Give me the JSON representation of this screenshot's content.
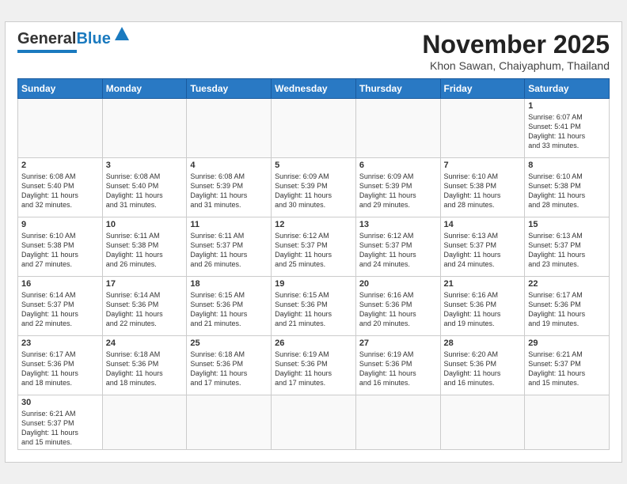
{
  "header": {
    "logo_general": "General",
    "logo_blue": "Blue",
    "month_title": "November 2025",
    "location": "Khon Sawan, Chaiyaphum, Thailand"
  },
  "weekdays": [
    "Sunday",
    "Monday",
    "Tuesday",
    "Wednesday",
    "Thursday",
    "Friday",
    "Saturday"
  ],
  "weeks": [
    [
      {
        "day": "",
        "info": ""
      },
      {
        "day": "",
        "info": ""
      },
      {
        "day": "",
        "info": ""
      },
      {
        "day": "",
        "info": ""
      },
      {
        "day": "",
        "info": ""
      },
      {
        "day": "",
        "info": ""
      },
      {
        "day": "1",
        "info": "Sunrise: 6:07 AM\nSunset: 5:41 PM\nDaylight: 11 hours\nand 33 minutes."
      }
    ],
    [
      {
        "day": "2",
        "info": "Sunrise: 6:08 AM\nSunset: 5:40 PM\nDaylight: 11 hours\nand 32 minutes."
      },
      {
        "day": "3",
        "info": "Sunrise: 6:08 AM\nSunset: 5:40 PM\nDaylight: 11 hours\nand 31 minutes."
      },
      {
        "day": "4",
        "info": "Sunrise: 6:08 AM\nSunset: 5:39 PM\nDaylight: 11 hours\nand 31 minutes."
      },
      {
        "day": "5",
        "info": "Sunrise: 6:09 AM\nSunset: 5:39 PM\nDaylight: 11 hours\nand 30 minutes."
      },
      {
        "day": "6",
        "info": "Sunrise: 6:09 AM\nSunset: 5:39 PM\nDaylight: 11 hours\nand 29 minutes."
      },
      {
        "day": "7",
        "info": "Sunrise: 6:10 AM\nSunset: 5:38 PM\nDaylight: 11 hours\nand 28 minutes."
      },
      {
        "day": "8",
        "info": "Sunrise: 6:10 AM\nSunset: 5:38 PM\nDaylight: 11 hours\nand 28 minutes."
      }
    ],
    [
      {
        "day": "9",
        "info": "Sunrise: 6:10 AM\nSunset: 5:38 PM\nDaylight: 11 hours\nand 27 minutes."
      },
      {
        "day": "10",
        "info": "Sunrise: 6:11 AM\nSunset: 5:38 PM\nDaylight: 11 hours\nand 26 minutes."
      },
      {
        "day": "11",
        "info": "Sunrise: 6:11 AM\nSunset: 5:37 PM\nDaylight: 11 hours\nand 26 minutes."
      },
      {
        "day": "12",
        "info": "Sunrise: 6:12 AM\nSunset: 5:37 PM\nDaylight: 11 hours\nand 25 minutes."
      },
      {
        "day": "13",
        "info": "Sunrise: 6:12 AM\nSunset: 5:37 PM\nDaylight: 11 hours\nand 24 minutes."
      },
      {
        "day": "14",
        "info": "Sunrise: 6:13 AM\nSunset: 5:37 PM\nDaylight: 11 hours\nand 24 minutes."
      },
      {
        "day": "15",
        "info": "Sunrise: 6:13 AM\nSunset: 5:37 PM\nDaylight: 11 hours\nand 23 minutes."
      }
    ],
    [
      {
        "day": "16",
        "info": "Sunrise: 6:14 AM\nSunset: 5:37 PM\nDaylight: 11 hours\nand 22 minutes."
      },
      {
        "day": "17",
        "info": "Sunrise: 6:14 AM\nSunset: 5:36 PM\nDaylight: 11 hours\nand 22 minutes."
      },
      {
        "day": "18",
        "info": "Sunrise: 6:15 AM\nSunset: 5:36 PM\nDaylight: 11 hours\nand 21 minutes."
      },
      {
        "day": "19",
        "info": "Sunrise: 6:15 AM\nSunset: 5:36 PM\nDaylight: 11 hours\nand 21 minutes."
      },
      {
        "day": "20",
        "info": "Sunrise: 6:16 AM\nSunset: 5:36 PM\nDaylight: 11 hours\nand 20 minutes."
      },
      {
        "day": "21",
        "info": "Sunrise: 6:16 AM\nSunset: 5:36 PM\nDaylight: 11 hours\nand 19 minutes."
      },
      {
        "day": "22",
        "info": "Sunrise: 6:17 AM\nSunset: 5:36 PM\nDaylight: 11 hours\nand 19 minutes."
      }
    ],
    [
      {
        "day": "23",
        "info": "Sunrise: 6:17 AM\nSunset: 5:36 PM\nDaylight: 11 hours\nand 18 minutes."
      },
      {
        "day": "24",
        "info": "Sunrise: 6:18 AM\nSunset: 5:36 PM\nDaylight: 11 hours\nand 18 minutes."
      },
      {
        "day": "25",
        "info": "Sunrise: 6:18 AM\nSunset: 5:36 PM\nDaylight: 11 hours\nand 17 minutes."
      },
      {
        "day": "26",
        "info": "Sunrise: 6:19 AM\nSunset: 5:36 PM\nDaylight: 11 hours\nand 17 minutes."
      },
      {
        "day": "27",
        "info": "Sunrise: 6:19 AM\nSunset: 5:36 PM\nDaylight: 11 hours\nand 16 minutes."
      },
      {
        "day": "28",
        "info": "Sunrise: 6:20 AM\nSunset: 5:36 PM\nDaylight: 11 hours\nand 16 minutes."
      },
      {
        "day": "29",
        "info": "Sunrise: 6:21 AM\nSunset: 5:37 PM\nDaylight: 11 hours\nand 15 minutes."
      }
    ],
    [
      {
        "day": "30",
        "info": "Sunrise: 6:21 AM\nSunset: 5:37 PM\nDaylight: 11 hours\nand 15 minutes."
      },
      {
        "day": "",
        "info": ""
      },
      {
        "day": "",
        "info": ""
      },
      {
        "day": "",
        "info": ""
      },
      {
        "day": "",
        "info": ""
      },
      {
        "day": "",
        "info": ""
      },
      {
        "day": "",
        "info": ""
      }
    ]
  ]
}
